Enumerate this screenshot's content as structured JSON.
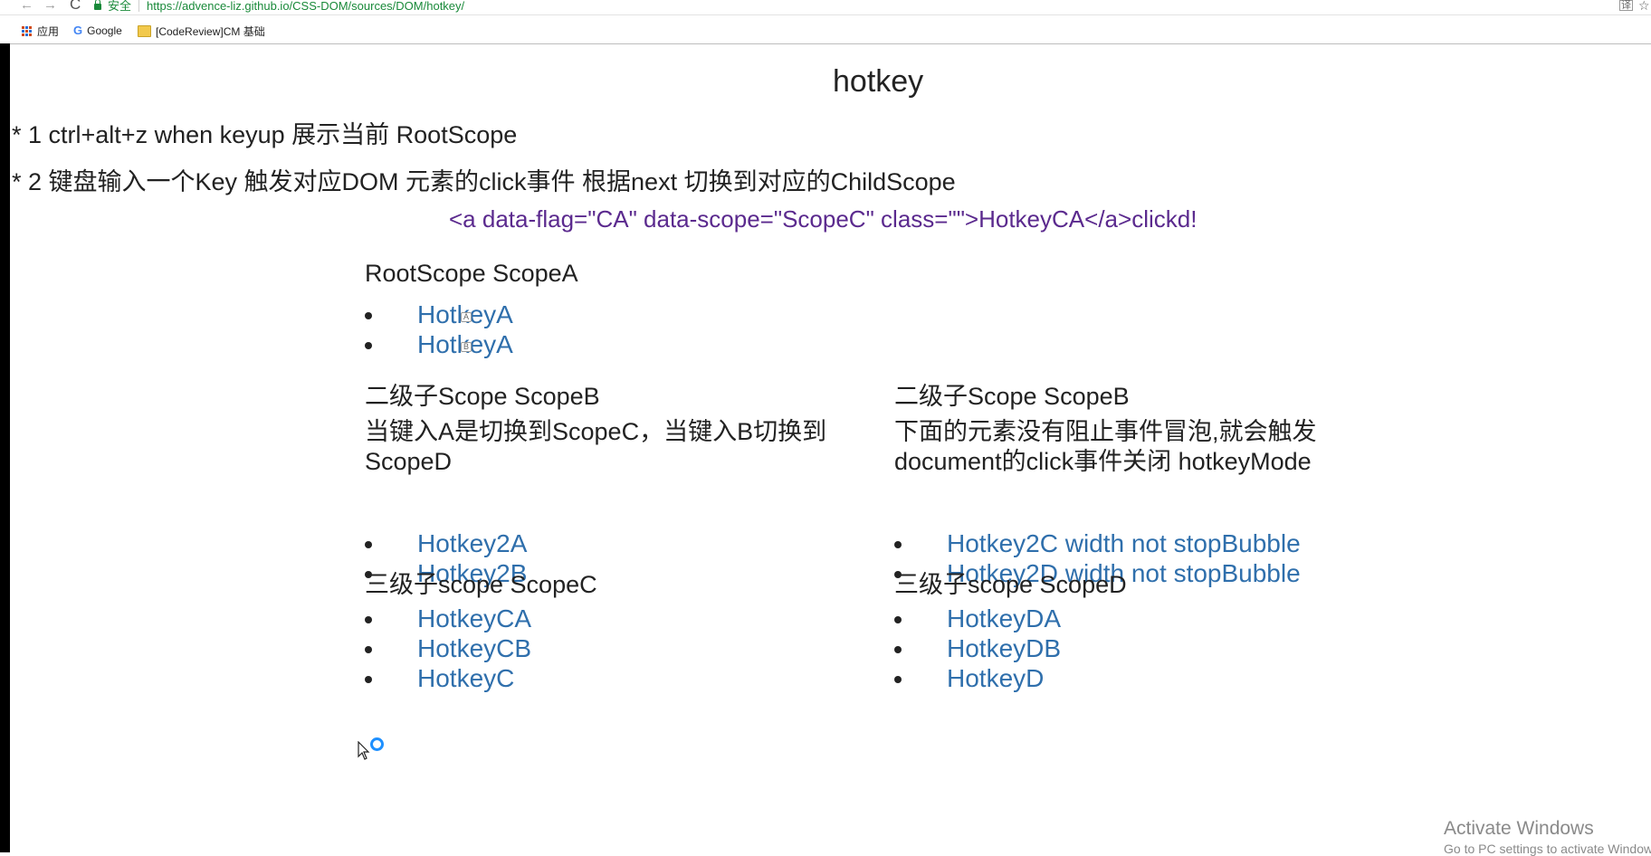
{
  "browser": {
    "nav": {
      "back": "←",
      "forward": "→",
      "reload": "C"
    },
    "secure_label": "安全",
    "url": "https://advence-liz.github.io/CSS-DOM/sources/DOM/hotkey/",
    "translate_glyph": "译",
    "star_glyph": "☆",
    "bookmarks": [
      {
        "label": "应用"
      },
      {
        "label": "Google"
      },
      {
        "label": "[CodeReview]CM 基础"
      }
    ]
  },
  "page": {
    "title": "hotkey",
    "desc_1": "* 1 ctrl+alt+z when keyup 展示当前 RootScope",
    "desc_2": "* 2 键盘输入一个Key 触发对应DOM 元素的click事件 根据next 切换到对应的ChildScope",
    "clicked_message": "<a data-flag=\"CA\" data-scope=\"ScopeC\" class=\"\">HotkeyCA</a>clickd!"
  },
  "scope_a": {
    "title": "RootScope ScopeA",
    "items": [
      {
        "label": "HotkeyA",
        "key": "A"
      },
      {
        "label": "HotkeyA",
        "key": "B"
      }
    ]
  },
  "scope_b_left": {
    "title": "二级子Scope ScopeB",
    "text": "当键入A是切换到ScopeC，当键入B切换到ScopeD",
    "items": [
      {
        "label": "Hotkey2A"
      },
      {
        "label": "Hotkey2B"
      }
    ]
  },
  "scope_b_right": {
    "title": "二级子Scope ScopeB",
    "text": "下面的元素没有阻止事件冒泡,就会触发document的click事件关闭 hotkeyMode",
    "items": [
      {
        "label": "Hotkey2C width not stopBubble"
      },
      {
        "label": "Hotkey2D width not stopBubble"
      }
    ]
  },
  "scope_c": {
    "title": "三级子scope ScopeC",
    "items": [
      {
        "label": "HotkeyCA"
      },
      {
        "label": "HotkeyCB"
      },
      {
        "label": "HotkeyC"
      }
    ]
  },
  "scope_d": {
    "title": "三级子scope ScopeD",
    "items": [
      {
        "label": "HotkeyDA"
      },
      {
        "label": "HotkeyDB"
      },
      {
        "label": "HotkeyD"
      }
    ]
  },
  "watermark": {
    "line1": "Activate Windows",
    "line2": "Go to PC settings to activate Windows."
  },
  "colors": {
    "link": "#2f6fac",
    "clicked_message": "#5b2a8e",
    "secure": "#1a8a3a",
    "text": "#222222"
  }
}
